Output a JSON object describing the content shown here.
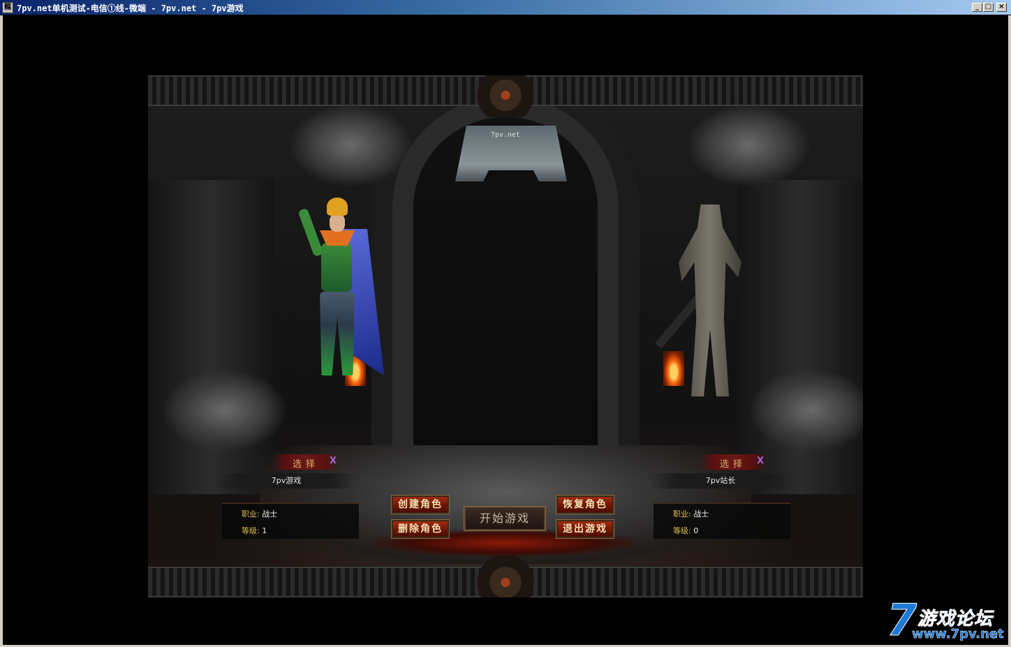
{
  "window": {
    "title": "7pv.net单机测试-电信①线-微端 - 7pv.net - 7pv游戏",
    "icon_label": "龍",
    "minimize": "_",
    "maximize": "□",
    "close": "×"
  },
  "scene": {
    "server_name": "7pv.net",
    "left_slot": {
      "select_label": "选择",
      "select_mark": "X",
      "character_name": "7pv游戏",
      "class_key": "职业:",
      "class_value": "战士",
      "level_key": "等级:",
      "level_value": "1"
    },
    "right_slot": {
      "select_label": "选择",
      "select_mark": "X",
      "character_name": "7pv站长",
      "class_key": "职业:",
      "class_value": "战士",
      "level_key": "等级:",
      "level_value": "0"
    },
    "buttons": {
      "create": "创建角色",
      "delete": "删除角色",
      "start": "开始游戏",
      "restore": "恢复角色",
      "exit": "退出游戏"
    }
  },
  "watermark": {
    "seven": "7",
    "cn": "游戏论坛",
    "url": "www.7pv.net"
  }
}
